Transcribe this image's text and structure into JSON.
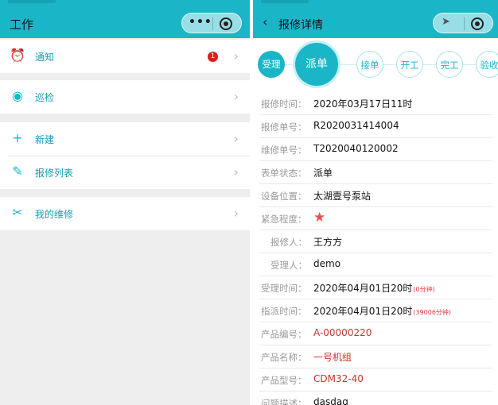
{
  "left": {
    "title": "工作",
    "capsule": {
      "more_icon": "more-dots-icon",
      "target_icon": "target-icon"
    },
    "menu": [
      {
        "id": "notice",
        "label": "通知",
        "icon": "bell-icon",
        "glyph": "⏰",
        "badge": "1"
      },
      {
        "id": "patrol",
        "label": "巡检",
        "icon": "location-pin-icon",
        "glyph": "◉"
      },
      {
        "id": "new",
        "label": "新建",
        "icon": "plus-icon",
        "glyph": "+"
      },
      {
        "id": "repair-list",
        "label": "报修列表",
        "icon": "edit-pencil-icon",
        "glyph": "✎"
      },
      {
        "id": "my-repair",
        "label": "我的维修",
        "icon": "tools-icon",
        "glyph": "✂"
      }
    ]
  },
  "right": {
    "title": "报修详情",
    "back_icon": "chevron-left-icon",
    "capsule": {
      "navigate_icon": "navigation-arrow-icon",
      "target_icon": "target-icon"
    },
    "steps": [
      {
        "label": "受理",
        "state": "done"
      },
      {
        "label": "派单",
        "state": "current"
      },
      {
        "label": "接单",
        "state": "todo"
      },
      {
        "label": "开工",
        "state": "todo"
      },
      {
        "label": "完工",
        "state": "todo"
      },
      {
        "label": "验收",
        "state": "todo"
      }
    ],
    "details": [
      {
        "key": "报修时间：",
        "value": "2020年03月17日11时"
      },
      {
        "key": "报修单号：",
        "value": "R2020031414004"
      },
      {
        "key": "维修单号：",
        "value": "T2020040120002"
      },
      {
        "key": "表单状态：",
        "value": "派单"
      },
      {
        "key": "设备位置：",
        "value": "太湖壹号泵站"
      },
      {
        "key": "紧急程度：",
        "value": "",
        "star": true
      },
      {
        "key": "报修人：",
        "value": "王方方",
        "indent": true
      },
      {
        "key": "受理人：",
        "value": "demo",
        "indent": true
      },
      {
        "key": "受理时间：",
        "value": "2020年04月01日20时",
        "note": "(0分钟)"
      },
      {
        "key": "指派时间：",
        "value": "2020年04月01日20时",
        "note": "(39006分钟)"
      },
      {
        "key": "产品编号：",
        "value": "A-00000220",
        "red": true
      },
      {
        "key": "产品名称：",
        "value": "一号机组",
        "red": true
      },
      {
        "key": "产品型号：",
        "value": "CDM32-40",
        "red": true
      },
      {
        "key": "问题描述：",
        "value": "dasdag"
      }
    ],
    "star_icon": "star-icon"
  },
  "colors": {
    "accent": "#1ab6c8",
    "badge": "#e21b1b",
    "red_text": "#c0392b",
    "star": "#e85050"
  }
}
